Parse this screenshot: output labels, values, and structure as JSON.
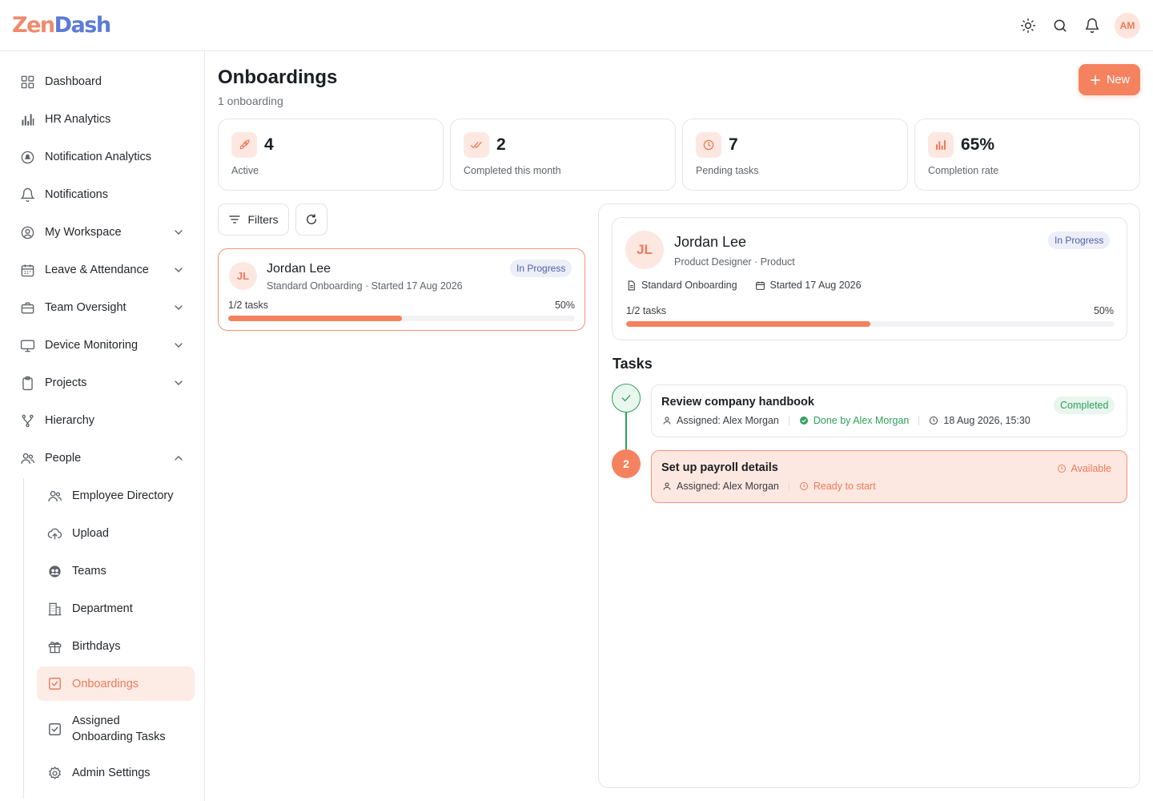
{
  "app": {
    "logo_part1": "Zen",
    "logo_part2": "Dash",
    "user_initials": "AM"
  },
  "sidebar": {
    "items": [
      {
        "label": "Dashboard"
      },
      {
        "label": "HR Analytics"
      },
      {
        "label": "Notification Analytics"
      },
      {
        "label": "Notifications"
      },
      {
        "label": "My Workspace"
      },
      {
        "label": "Leave & Attendance"
      },
      {
        "label": "Team Oversight"
      },
      {
        "label": "Device Monitoring"
      },
      {
        "label": "Projects"
      },
      {
        "label": "Hierarchy"
      },
      {
        "label": "People"
      }
    ],
    "people_sub": [
      {
        "label": "Employee Directory"
      },
      {
        "label": "Upload"
      },
      {
        "label": "Teams"
      },
      {
        "label": "Department"
      },
      {
        "label": "Birthdays"
      },
      {
        "label": "Onboardings"
      },
      {
        "label": "Assigned Onboarding Tasks"
      },
      {
        "label": "Admin Settings"
      }
    ]
  },
  "page": {
    "title": "Onboardings",
    "count": "1 onboarding",
    "new_label": "New"
  },
  "stats": [
    {
      "value": "4",
      "label": "Active",
      "icon": "rocket-icon"
    },
    {
      "value": "2",
      "label": "Completed this month",
      "icon": "double-check-icon"
    },
    {
      "value": "7",
      "label": "Pending tasks",
      "icon": "clock-icon"
    },
    {
      "value": "65%",
      "label": "Completion rate",
      "icon": "bar-chart-icon"
    }
  ],
  "toolbar": {
    "filters_label": "Filters"
  },
  "list": [
    {
      "initials": "JL",
      "name": "Jordan Lee",
      "subtitle": "Standard Onboarding · Started 17 Aug 2026",
      "status": "In Progress",
      "tasks_label": "1/2 tasks",
      "percent_label": "50%",
      "progress": 0.5
    }
  ],
  "detail": {
    "initials": "JL",
    "name": "Jordan Lee",
    "role": "Product Designer · Product",
    "status": "In Progress",
    "template": "Standard Onboarding",
    "started": "Started 17 Aug 2026",
    "tasks_label": "1/2 tasks",
    "percent_label": "50%",
    "progress": 0.5,
    "tasks_heading": "Tasks",
    "tasks": [
      {
        "title": "Review company handbook",
        "assigned": "Assigned: Alex Morgan",
        "done_by": "Done by Alex Morgan",
        "timestamp": "18 Aug 2026, 15:30",
        "status": "Completed"
      },
      {
        "step": "2",
        "title": "Set up payroll details",
        "assigned": "Assigned: Alex Morgan",
        "ready": "Ready to start",
        "status": "Available"
      }
    ]
  },
  "colors": {
    "accent": "#f4825f",
    "success": "#2da05b",
    "badge_blue": "#4d5fa8"
  }
}
